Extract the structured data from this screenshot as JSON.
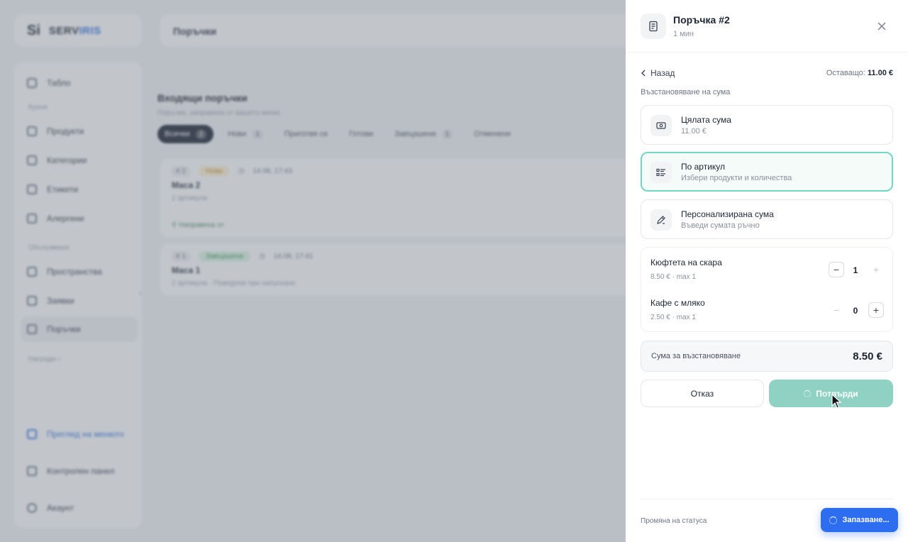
{
  "app": {
    "logo_mark": "Si",
    "logo_text_a": "SERV",
    "logo_text_b": "IRIS",
    "accent_color": "#2f6fe0"
  },
  "sidebar": {
    "items": [
      {
        "label": "Табло",
        "icon": "grid-icon"
      },
      {
        "label": "Продукти",
        "icon": "box-icon"
      },
      {
        "label": "Категории",
        "icon": "category-icon"
      },
      {
        "label": "Етикети",
        "icon": "tag-icon"
      },
      {
        "label": "Алергени",
        "icon": "allergen-icon"
      },
      {
        "label": "Пространства",
        "icon": "location-icon"
      },
      {
        "label": "Заявки",
        "icon": "request-icon"
      },
      {
        "label": "Поръчки",
        "icon": "orders-icon"
      }
    ],
    "section_menu": "Кухня",
    "section_service": "Обслужване",
    "more": "Награди",
    "preview_link": "Преглед на менюто",
    "control_panel": "Контролен панел",
    "account": "Акаунт"
  },
  "topbar": {
    "title": "Поръчки"
  },
  "orders": {
    "title": "Входящи поръчки",
    "subtitle": "Поръчки, направени от вашето меню",
    "filters": [
      {
        "label": "Всички",
        "count": "2"
      },
      {
        "label": "Нови",
        "count": "1"
      },
      {
        "label": "Приготвя се",
        "count": ""
      },
      {
        "label": "Готови",
        "count": ""
      },
      {
        "label": "Завършени",
        "count": "1"
      },
      {
        "label": "Отменени",
        "count": ""
      }
    ],
    "cards": [
      {
        "num": "# 2",
        "status": "Нова",
        "time": "14.08, 17:43",
        "table": "Маса 2",
        "sub": "2 артикула",
        "by": "Направена от"
      },
      {
        "num": "# 1",
        "status": "Завършена",
        "time": "14.08, 17:41",
        "table": "Маса 1",
        "sub": "2 артикула · Поведени при напускане"
      }
    ]
  },
  "drawer": {
    "title": "Поръчка #2",
    "subtitle": "1 мин",
    "back_label": "Назад",
    "remaining_label": "Оставащо:",
    "remaining_value": "11.00 €",
    "section_label": "Възстановяване на сума",
    "options": [
      {
        "title": "Цялата сума",
        "subtitle": "11.00 €",
        "icon": "cash-icon",
        "selected": false
      },
      {
        "title": "По артикул",
        "subtitle": "Избери продукти и количества",
        "icon": "list-icon",
        "selected": true
      },
      {
        "title": "Персонализирана сума",
        "subtitle": "Въведи сумата ръчно",
        "icon": "edit-amount-icon",
        "selected": false
      }
    ],
    "items": [
      {
        "name": "Кюфтета на скара",
        "meta": "8.50 € · max 1",
        "qty": "1"
      },
      {
        "name": "Кафе с мляко",
        "meta": "2.50 € · max 1",
        "qty": "0"
      }
    ],
    "refund_label": "Сума за възстановяване",
    "refund_value": "8.50 €",
    "cancel_label": "Отказ",
    "confirm_label": "Потвърди",
    "status_change_label": "Промяна на статуса",
    "selected_border_color": "#6fd7c2",
    "confirm_color": "#8fd1c3"
  },
  "toast": {
    "label": "Запазване...",
    "color": "#2d6df0"
  }
}
